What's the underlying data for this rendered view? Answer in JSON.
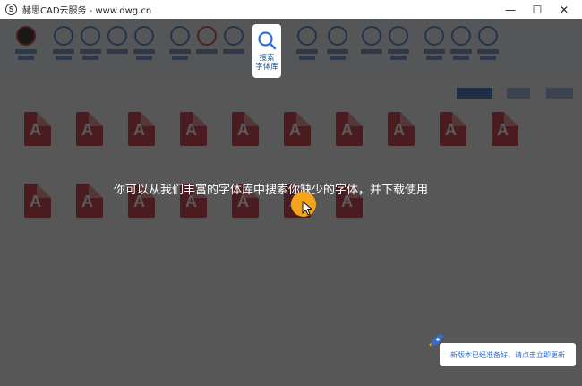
{
  "window": {
    "logo_glyph": "S",
    "title": "赫思CAD云服务 - www.dwg.cn",
    "minimize_glyph": "—",
    "maximize_glyph": "☐",
    "close_glyph": "✕"
  },
  "toolbar": {
    "highlighted_tool": {
      "label_line1": "搜索",
      "label_line2": "字体库",
      "icon": "search-icon"
    },
    "accent_color": "#4d7fc4"
  },
  "tip": {
    "text": "你可以从我们丰富的字体库中搜索你缺少的字体，并下载使用"
  },
  "update": {
    "message": "新版本已经准备好，请点击立即更新"
  },
  "colors": {
    "overlay": "rgba(20,20,20,0.70)",
    "cursor": "#f3a31c",
    "link": "#2f6fd6",
    "file_icon": "#c8303a"
  }
}
